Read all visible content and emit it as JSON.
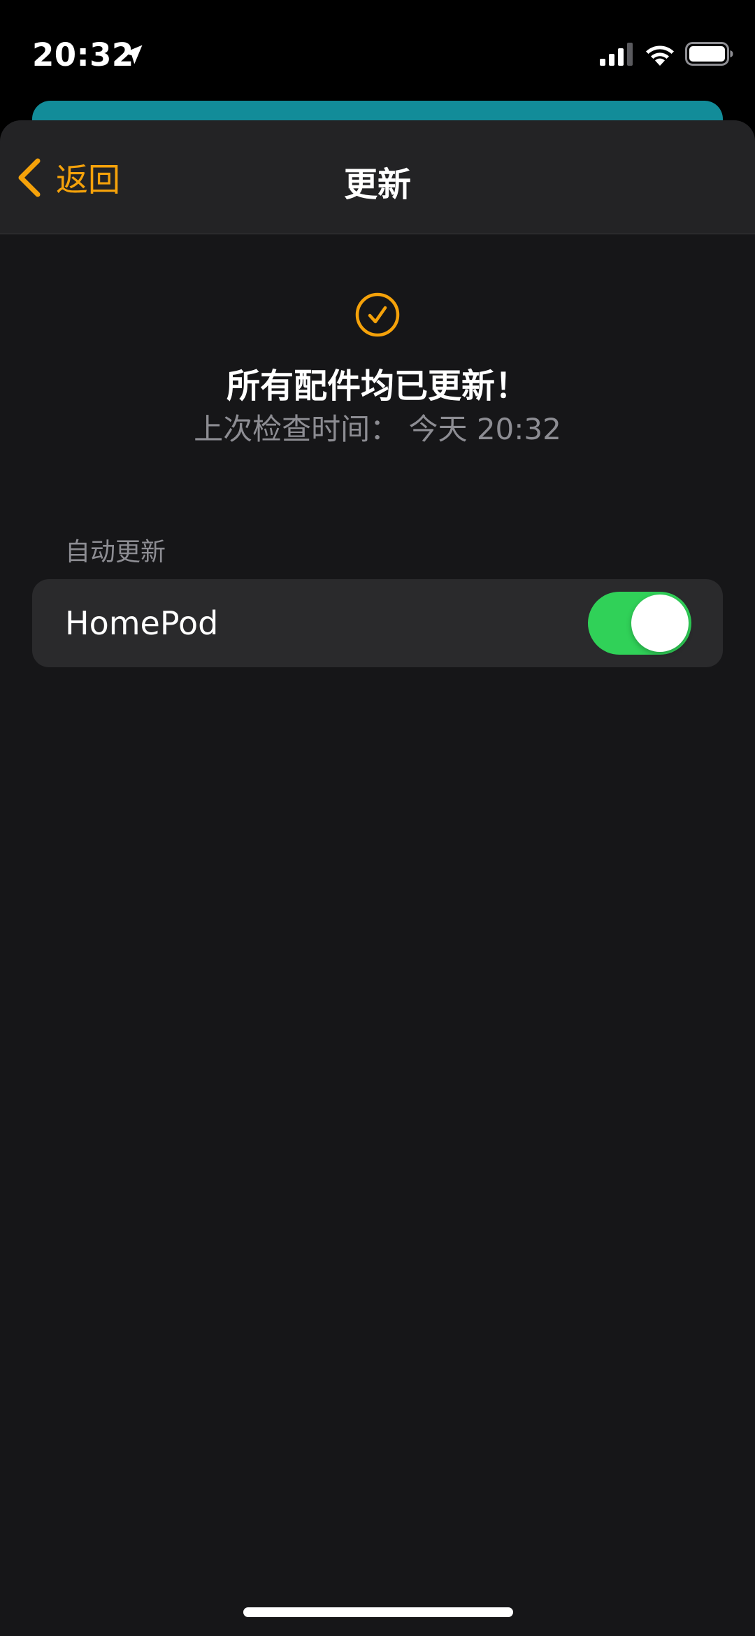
{
  "status_bar": {
    "time": "20:32",
    "icons": [
      "location-arrow-icon",
      "cellular-signal-icon",
      "wifi-icon",
      "battery-icon"
    ]
  },
  "nav": {
    "back_label": "返回",
    "title": "更新"
  },
  "status": {
    "icon": "checkmark-circle-icon",
    "headline": "所有配件均已更新！",
    "last_checked": "上次检查时间：  今天 20:32"
  },
  "auto_update": {
    "section_header": "自动更新",
    "items": [
      {
        "label": "HomePod",
        "enabled": true
      }
    ]
  },
  "colors": {
    "accent": "#f5a20a",
    "toggle_on": "#30d158",
    "background": "#161618",
    "nav_background": "#232325",
    "group_background": "#2a2a2c",
    "back_sheet": "#128c99"
  }
}
